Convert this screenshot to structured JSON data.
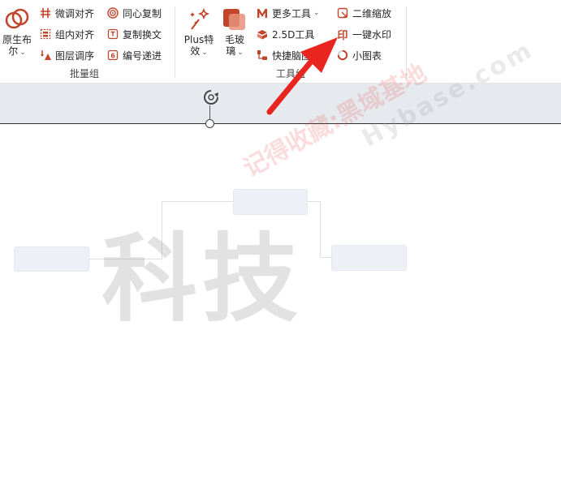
{
  "ribbon": {
    "batch_group": {
      "label": "批量组",
      "big_button": {
        "label_line1": "原生布",
        "label_line2": "尔",
        "icon": "boolean-rings-icon"
      },
      "col1": [
        {
          "label": "微调对齐",
          "icon": "fine-align-icon"
        },
        {
          "label": "组内对齐",
          "icon": "group-align-icon"
        },
        {
          "label": "图层调序",
          "icon": "layer-order-icon"
        }
      ],
      "col2": [
        {
          "label": "同心复制",
          "icon": "concentric-copy-icon"
        },
        {
          "label": "复制换文",
          "icon": "copy-replace-text-icon"
        },
        {
          "label": "编号递进",
          "icon": "number-increment-icon"
        }
      ]
    },
    "tools_group": {
      "label": "工具组",
      "plus_button": {
        "label_line1": "Plus特",
        "label_line2": "效",
        "icon": "sparkle-wand-icon"
      },
      "glass_button": {
        "label_line1": "毛玻",
        "label_line2": "璃",
        "icon": "frosted-glass-icon"
      },
      "col1": [
        {
          "label": "更多工具",
          "icon": "m-logo-icon",
          "has_dropdown": true
        },
        {
          "label": "2.5D工具",
          "icon": "2-5d-icon"
        },
        {
          "label": "快捷脑图",
          "icon": "mindmap-icon"
        }
      ],
      "col2": [
        {
          "label": "二维缩放",
          "icon": "2d-scale-icon"
        },
        {
          "label": "一键水印",
          "icon": "stamp-icon",
          "icon_glyph": "印"
        },
        {
          "label": "小图表",
          "icon": "mini-chart-icon"
        }
      ]
    },
    "accent_color": "#c0452a"
  },
  "slide": {
    "big_text": "科技"
  },
  "watermarks": {
    "text_red": "记得收藏:黑域基地",
    "text_gray": "Hybase.com"
  }
}
